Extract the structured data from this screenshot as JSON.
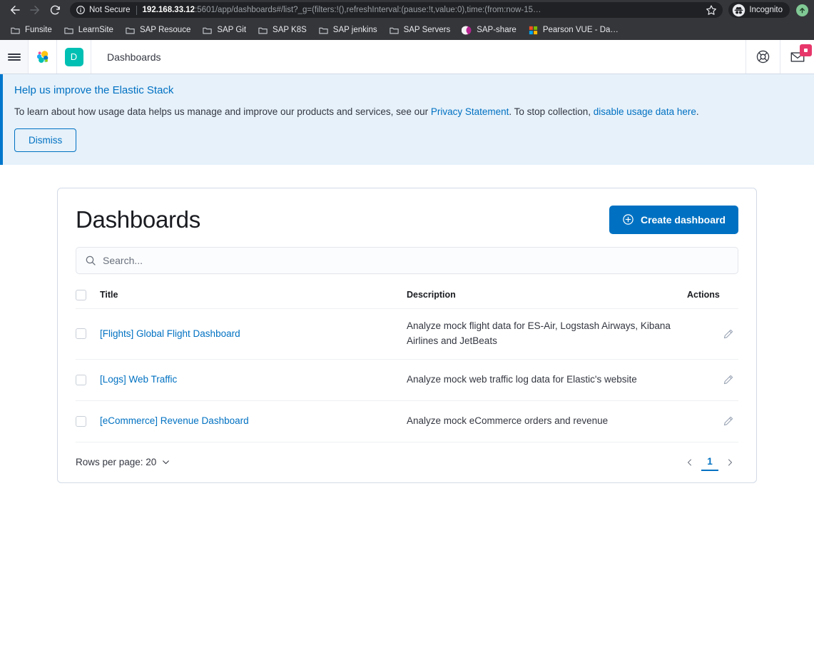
{
  "browser": {
    "nav": {
      "back_label": "Back",
      "forward_label": "Forward",
      "reload_label": "Reload"
    },
    "omnibox": {
      "security_label": "Not Secure",
      "url_host": "192.168.33.12",
      "url_path": ":5601/app/dashboards#/list?_g=(filters:!(),refreshInterval:(pause:!t,value:0),time:(from:now-15…",
      "star_label": "Bookmark this tab"
    },
    "incognito_label": "Incognito",
    "bookmarks": [
      {
        "label": "Funsite",
        "icon": "folder-icon"
      },
      {
        "label": "LearnSite",
        "icon": "folder-icon"
      },
      {
        "label": "SAP Resouce",
        "icon": "folder-icon"
      },
      {
        "label": "SAP Git",
        "icon": "folder-icon"
      },
      {
        "label": "SAP K8S",
        "icon": "folder-icon"
      },
      {
        "label": "SAP jenkins",
        "icon": "folder-icon"
      },
      {
        "label": "SAP Servers",
        "icon": "folder-icon"
      },
      {
        "label": "SAP-share",
        "icon": "sap-share-icon"
      },
      {
        "label": "Pearson VUE - Da…",
        "icon": "microsoft-icon"
      }
    ]
  },
  "kibana_header": {
    "menu_label": "Toggle primary navigation",
    "logo_label": "Elastic",
    "space_initial": "D",
    "breadcrumb": "Dashboards",
    "help_label": "Help menu",
    "news_label": "News feed"
  },
  "banner": {
    "title": "Help us improve the Elastic Stack",
    "text_before": "To learn about how usage data helps us manage and improve our products and services, see our ",
    "link_privacy": "Privacy Statement",
    "text_middle": ". To stop collection, ",
    "link_disable": "disable usage data here",
    "text_after": ".",
    "dismiss_label": "Dismiss",
    "accent_color": "#0077cc",
    "background_color": "#e6f1fa"
  },
  "main": {
    "title": "Dashboards",
    "create_button": "Create dashboard",
    "create_button_color": "#0071c2",
    "search": {
      "placeholder": "Search...",
      "value": ""
    },
    "table": {
      "columns": [
        "Title",
        "Description",
        "Actions"
      ],
      "rows": [
        {
          "title": "[Flights] Global Flight Dashboard",
          "description": "Analyze mock flight data for ES-Air, Logstash Airways, Kibana Airlines and JetBeats",
          "action": "edit-icon",
          "selected": false
        },
        {
          "title": "[Logs] Web Traffic",
          "description": "Analyze mock web traffic log data for Elastic's website",
          "action": "edit-icon",
          "selected": false
        },
        {
          "title": "[eCommerce] Revenue Dashboard",
          "description": "Analyze mock eCommerce orders and revenue",
          "action": "edit-icon",
          "selected": false
        }
      ]
    },
    "footer": {
      "rows_per_page_label": "Rows per page: 20",
      "current_page": "1",
      "prev_label": "Previous page",
      "next_label": "Next page"
    }
  }
}
